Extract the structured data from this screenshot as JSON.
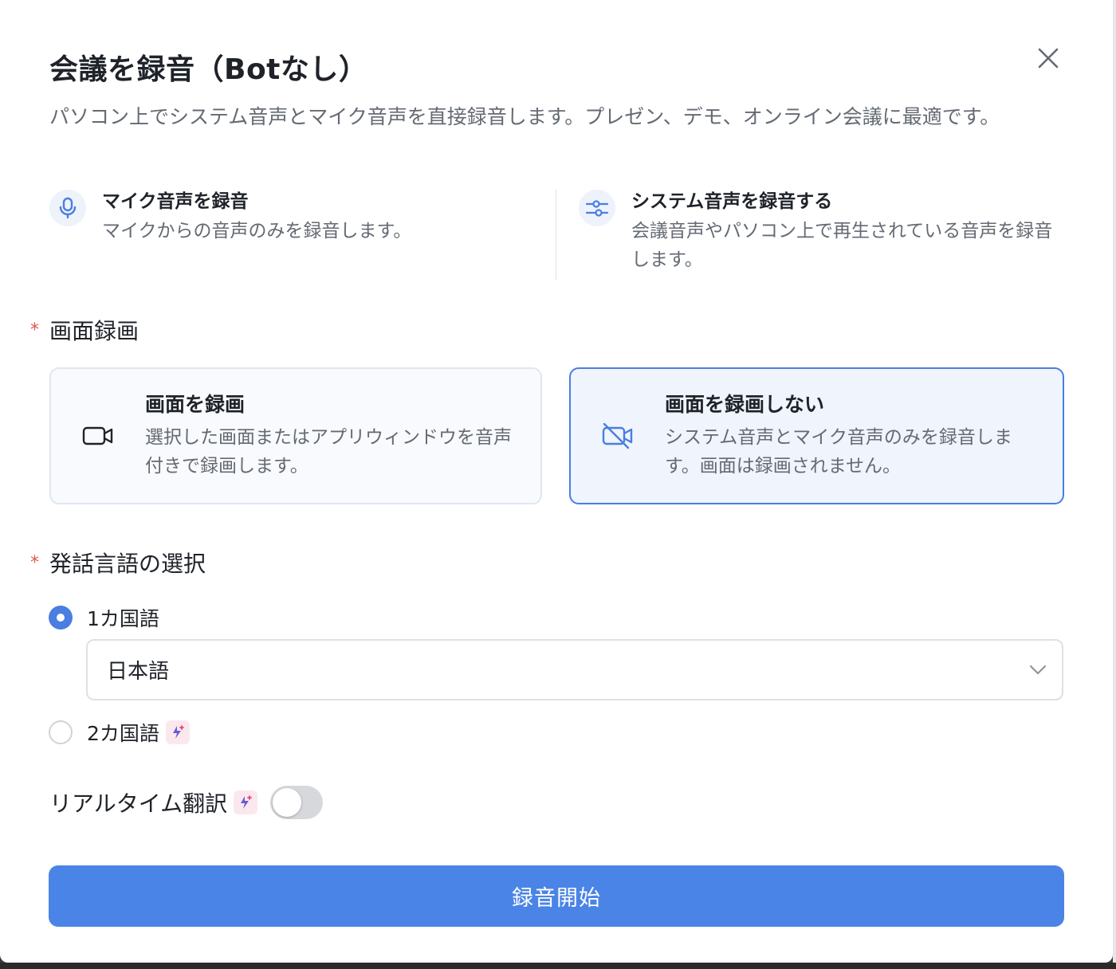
{
  "dialog": {
    "title": "会議を録音（Botなし）",
    "description": "パソコン上でシステム音声とマイク音声を直接録音します。プレゼン、デモ、オンライン会議に最適です。",
    "close_icon": "close-icon"
  },
  "features": [
    {
      "icon": "microphone-icon",
      "title": "マイク音声を録音",
      "desc": "マイクからの音声のみを録音します。"
    },
    {
      "icon": "sliders-icon",
      "title": "システム音声を録音する",
      "desc": "会議音声やパソコン上で再生されている音声を録音します。"
    }
  ],
  "screen_recording": {
    "label": "画面録画",
    "required_mark": "*",
    "options": [
      {
        "icon": "video-camera-icon",
        "title": "画面を録画",
        "desc": "選択した画面またはアプリウィンドウを音声付きで録画します。",
        "selected": false
      },
      {
        "icon": "video-off-icon",
        "title": "画面を録画しない",
        "desc": "システム音声とマイク音声のみを録音します。画面は録画されません。",
        "selected": true
      }
    ]
  },
  "language": {
    "label": "発話言語の選択",
    "required_mark": "*",
    "options": [
      {
        "label": "1カ国語",
        "checked": true
      },
      {
        "label": "2カ国語",
        "checked": false,
        "badge": "ai-sparkle-icon"
      }
    ],
    "selected_language": "日本語"
  },
  "translation": {
    "label": "リアルタイム翻訳",
    "badge": "ai-sparkle-icon",
    "enabled": false
  },
  "start_button": "録音開始",
  "colors": {
    "accent": "#4a84e6",
    "selected_border": "#4a7ee0",
    "required": "#e5534b"
  }
}
